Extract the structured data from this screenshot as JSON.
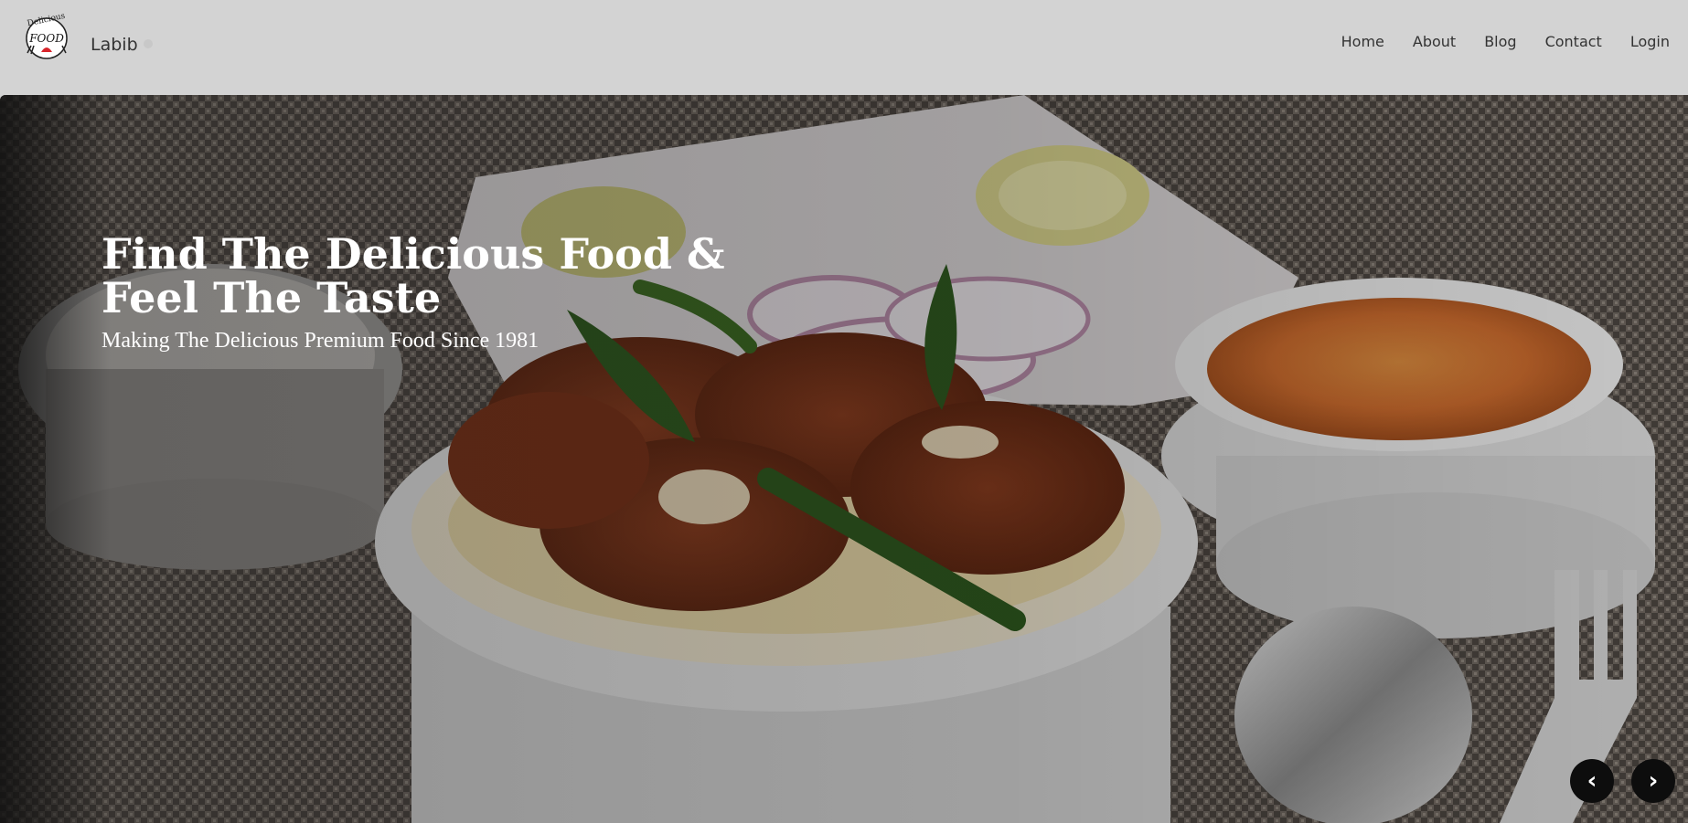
{
  "brand": {
    "logo_text_top": "Delicious",
    "logo_text_main": "FOOD",
    "name": "Labib"
  },
  "nav": {
    "items": [
      {
        "label": "Home"
      },
      {
        "label": "About"
      },
      {
        "label": "Blog"
      },
      {
        "label": "Contact"
      },
      {
        "label": "Login"
      }
    ]
  },
  "hero": {
    "title": "Find The Delicious Food & Feel The Taste",
    "subtitle": "Making The Delicious Premium Food Since 1981",
    "prev_label": "‹",
    "next_label": "›"
  },
  "colors": {
    "navbar_bg": "#d3d3d3",
    "hero_text": "#ffffff",
    "control_bg": "#0d0d0d"
  }
}
